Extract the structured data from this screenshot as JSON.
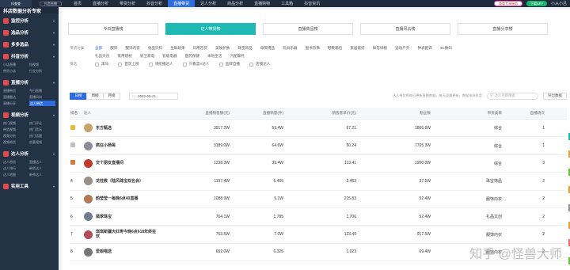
{
  "topbar": {
    "logo": "抖查查",
    "dropdown": "抖音直播",
    "nav": [
      "首页",
      "直播分析",
      "带货分析",
      "抖音分析",
      "直播带货",
      "达人分析",
      "商品分析",
      "直播购物",
      "工具箱",
      "抖音资讯"
    ],
    "active_index": 4,
    "vip_label": "查看专享服务",
    "download_label": "下载APP",
    "user": "小从小吕"
  },
  "sidebar": {
    "brand": "抖店数据分析专家",
    "groups": [
      {
        "title": "监控分析",
        "items": []
      },
      {
        "title": "选品分析",
        "items": []
      },
      {
        "title": "多多选品",
        "items": []
      },
      {
        "title": "抖音分析",
        "items": [
          "小店直播",
          "短视频",
          "带货小店",
          "行业分析"
        ]
      },
      {
        "title": "直播分析",
        "items": [
          "直播带货",
          "今日直播",
          "直播雷达",
          "直播风向",
          "直播分享",
          "达人带货"
        ]
      },
      {
        "title": "视频分析",
        "items": [
          "热门视频",
          "热门评论",
          "带货视频",
          "热门音乐",
          "视频分析",
          "热门话题",
          "视频带货",
          "创意视频"
        ]
      },
      {
        "title": "达人分析",
        "items": [
          "达人带货",
          "直播达人",
          "达人排行",
          "带货达人",
          "达人地图",
          "新秀达人"
        ]
      },
      {
        "title": "实用工具",
        "items": []
      }
    ],
    "active_item": "达人带货"
  },
  "tabs": [
    "今日直播榜",
    "达人带货榜",
    "直播商品榜",
    "直播风云榜",
    "直播分享榜"
  ],
  "active_tab": 1,
  "filters": {
    "category_label": "带货分类",
    "categories_row1": [
      "全部",
      "服饰",
      "服饰内衣",
      "食品饮料",
      "生鲜蔬果",
      "日用百货",
      "美妆护肤",
      "珠宝饰品",
      "母婴用品",
      "玩具乐器",
      "图书音像",
      "鞋靴箱包",
      "家居家纺",
      "鲜花绿植",
      "运动户外",
      "钟表配饰",
      "3C数码"
    ],
    "categories_row2": [
      "礼品文创",
      "家用建材",
      "厨卫家电",
      "智能电器",
      "医药保健",
      "本地生活",
      "汽配摩托"
    ],
    "screen_label": "筛选",
    "checks": [
      "黑马",
      "首次上榜",
      "领航播达人",
      "只看蓝V达人",
      "品牌自播",
      "店铺达人"
    ]
  },
  "controls": {
    "periods": [
      "日榜",
      "周榜",
      "月榜"
    ],
    "active_period": 0,
    "date": "2022-05-21",
    "note": "达人带货榜每日更新直播数据，每天凌晨更新，数据来源抖音",
    "search_placeholder": "达人名称搜索",
    "export_label": "导出数据"
  },
  "table": {
    "headers": [
      "排名",
      "达人",
      "直播销售额(元)",
      "直播销量(件)",
      "销售客单价(元)",
      "粉丝数",
      "带货类目",
      "直播场次"
    ],
    "rows": [
      {
        "rank": "1",
        "name": "东方甄选",
        "sales": "3517.2W",
        "volume": "53.4W",
        "price": "67.21",
        "fans": "1806.6W",
        "category": "综合",
        "sessions": "1",
        "rank_color": "#e8b93a",
        "avatar": "#c8a36a"
      },
      {
        "rank": "2",
        "name": "疯狂小杨哥",
        "sales": "3189.0W",
        "volume": "64.6W",
        "price": "50.24",
        "fans": "7705.3W",
        "category": "综合",
        "sessions": "1",
        "rank_color": "#b9c0cc",
        "avatar": "#8a8f96"
      },
      {
        "rank": "3",
        "name": "交个朋友直播间",
        "sales": "1238.3W",
        "volume": "35.4W",
        "price": "113.41",
        "fans": "1950.0W",
        "category": "综合",
        "sessions": "3",
        "rank_color": "#d07a3c",
        "avatar": "#c0392b"
      },
      {
        "rank": "4",
        "name": "龙柱教（陆风珠宝双名会）",
        "sales": "1197.4W",
        "volume": "5,465",
        "price": "2,462",
        "fans": "37.5W",
        "category": "珠宝饰品",
        "sessions": "2",
        "rank_color": "",
        "avatar": "#9a8f86"
      },
      {
        "rank": "5",
        "name": "韵莹莹一每晚6点40直播",
        "sales": "1088.9W",
        "volume": "5.1W",
        "price": "215.83",
        "fans": "52.4W",
        "category": "服饰内衣",
        "sessions": "2",
        "rank_color": "",
        "avatar": "#b07a55"
      },
      {
        "rank": "6",
        "name": "翡翠珠宝",
        "sales": "764.1W",
        "volume": "1,785",
        "price": "1,706",
        "fans": "52.4W",
        "category": "礼品文创",
        "sessions": "2",
        "rank_color": "",
        "avatar": "#6f7d8c"
      },
      {
        "rank": "7",
        "name": "琪琪新疆大红枣今晚6点618年终狂欢",
        "sales": "753.5W",
        "volume": "7.0W",
        "price": "123.49",
        "fans": "917.5W",
        "category": "服饰内衣",
        "sessions": "2",
        "rank_color": "",
        "avatar": "#b34a5a"
      },
      {
        "rank": "8",
        "name": "爱眼喵选",
        "sales": "652.0W",
        "volume": "6,325",
        "price": "1,023",
        "fans": "69.4W",
        "category": "服饰内衣",
        "sessions": "2",
        "rank_color": "",
        "avatar": "#777"
      }
    ]
  },
  "watermark": "知乎 @怪兽大师",
  "colors": {
    "accent": "#2e6de0",
    "tab_active": "#1fb9b4",
    "sidebar": "#243246",
    "topbar": "#1f2b3d",
    "edge_marks": [
      "#1fb9b4",
      "#e6a23c",
      "#67c23a",
      "#e6a23c",
      "#909399",
      "#e6a23c",
      "#f56c6c",
      "#67c23a"
    ]
  }
}
